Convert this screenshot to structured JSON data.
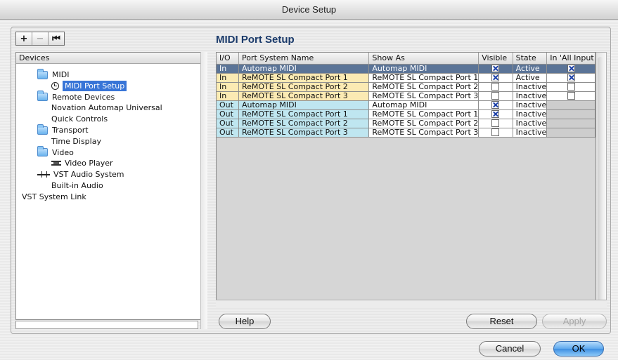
{
  "window": {
    "title": "Device Setup"
  },
  "toolbar": {
    "add_label": "+",
    "remove_label": "−",
    "reset_label": "⏮"
  },
  "devices_header": "Devices",
  "tree": [
    {
      "label": "MIDI",
      "icon": "folder-icon",
      "level": 1
    },
    {
      "label": "MIDI Port Setup",
      "icon": "clock-icon",
      "level": 2,
      "selected": true
    },
    {
      "label": "Remote Devices",
      "icon": "folder-icon",
      "level": 1
    },
    {
      "label": "Novation Automap Universal",
      "icon": "",
      "level": 2
    },
    {
      "label": "Quick Controls",
      "icon": "",
      "level": 2
    },
    {
      "label": "Transport",
      "icon": "folder-icon",
      "level": 1
    },
    {
      "label": "Time Display",
      "icon": "",
      "level": 2
    },
    {
      "label": "Video",
      "icon": "folder-icon",
      "level": 1
    },
    {
      "label": "Video Player",
      "icon": "video-icon",
      "level": 2
    },
    {
      "label": "VST Audio System",
      "icon": "vst-icon",
      "level": 1
    },
    {
      "label": "Built-in Audio",
      "icon": "",
      "level": 2
    },
    {
      "label": "VST System Link",
      "icon": "",
      "level": 0
    }
  ],
  "section_title": "MIDI Port Setup",
  "table": {
    "columns": [
      "I/O",
      "Port System Name",
      "Show As",
      "Visible",
      "State",
      "In 'All Input"
    ],
    "rows": [
      {
        "io": "In",
        "name": "Automap MIDI",
        "show_as": "Automap MIDI",
        "visible": true,
        "state": "Active",
        "all_input": true
      },
      {
        "io": "In",
        "name": "ReMOTE SL Compact Port 1",
        "show_as": "ReMOTE SL Compact Port 1",
        "visible": true,
        "state": "Active",
        "all_input": true
      },
      {
        "io": "In",
        "name": "ReMOTE SL Compact Port 2",
        "show_as": "ReMOTE SL Compact Port 2",
        "visible": false,
        "state": "Inactive",
        "all_input": false
      },
      {
        "io": "In",
        "name": "ReMOTE SL Compact Port 3",
        "show_as": "ReMOTE SL Compact Port 3",
        "visible": false,
        "state": "Inactive",
        "all_input": false
      },
      {
        "io": "Out",
        "name": "Automap MIDI",
        "show_as": "Automap MIDI",
        "visible": true,
        "state": "Inactive",
        "all_input": null
      },
      {
        "io": "Out",
        "name": "ReMOTE SL Compact Port 1",
        "show_as": "ReMOTE SL Compact Port 1",
        "visible": true,
        "state": "Inactive",
        "all_input": null
      },
      {
        "io": "Out",
        "name": "ReMOTE SL Compact Port 2",
        "show_as": "ReMOTE SL Compact Port 2",
        "visible": false,
        "state": "Inactive",
        "all_input": null
      },
      {
        "io": "Out",
        "name": "ReMOTE SL Compact Port 3",
        "show_as": "ReMOTE SL Compact Port 3",
        "visible": false,
        "state": "Inactive",
        "all_input": null
      }
    ],
    "selected_row": 0
  },
  "buttons": {
    "help": "Help",
    "reset": "Reset",
    "apply": "Apply",
    "cancel": "Cancel",
    "ok": "OK"
  },
  "colors": {
    "in_row": "#fbeab3",
    "out_row": "#bfe6f0",
    "selection": "#5b7497",
    "default_button": "#3e8fe2"
  }
}
